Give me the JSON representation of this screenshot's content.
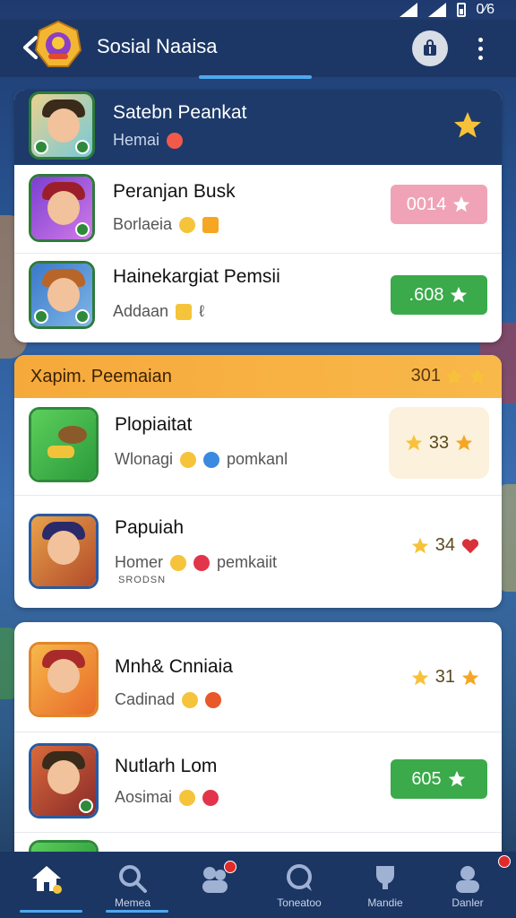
{
  "status": {
    "time": "0⁄6"
  },
  "app": {
    "title": "Sosial Naaisa"
  },
  "featured": {
    "name": "Satebn Peankat",
    "sub": "Hemai"
  },
  "list1": [
    {
      "name": "Peranjan Busk",
      "sub": "Borlaeia",
      "pill": "0014",
      "pill_color": "pink"
    },
    {
      "name": "Hainekargiat Pemsii",
      "sub": "Addaan",
      "pill": ".608",
      "pill_color": "green"
    }
  ],
  "section2": {
    "title": "Xapim. Peemaian",
    "score": "301"
  },
  "list2": [
    {
      "name": "Plopiaitat",
      "sub": "Wlonagi",
      "tag": "pomkanl",
      "score": "33"
    },
    {
      "name": "Papuiah",
      "sub": "Homer",
      "tag": "pemkaiit",
      "extra": "SRODSN",
      "score": "34"
    }
  ],
  "list3": [
    {
      "name": "Mnh& Cnniaia",
      "sub": "Cadinad",
      "score": "31"
    },
    {
      "name": "Nutlarh Lom",
      "sub": "Aosimai",
      "pill": "605",
      "pill_color": "green"
    }
  ],
  "nav": [
    {
      "label": ""
    },
    {
      "label": "Memea"
    },
    {
      "label": ""
    },
    {
      "label": "Toneatoo"
    },
    {
      "label": "Mandie"
    },
    {
      "label": "Danler"
    }
  ],
  "colors": {
    "header": "#1c3766",
    "accent": "#4fa8ee",
    "orange": "#f6a93b",
    "green": "#3aaa4a",
    "pink": "#f0a3b6"
  }
}
